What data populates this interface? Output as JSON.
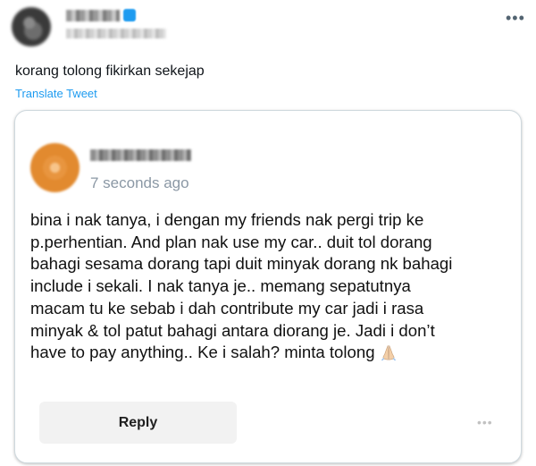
{
  "tweet": {
    "text": "korang tolong fikirkan sekejap",
    "translate_label": "Translate Tweet",
    "more_icon": "more-horizontal-icon"
  },
  "embedded_post": {
    "timestamp": "7 seconds ago",
    "message": "bina i nak tanya, i dengan my friends nak pergi trip ke\np.perhentian. And plan nak use my car.. duit tol dorang\nbahagi sesama dorang tapi duit minyak dorang nk bahagi\ninclude i sekali. I nak tanya je.. memang sepatutnya\nmacam tu ke sebab i dah contribute my car jadi i rasa\nminyak & tol patut bahagi antara diorang je. Jadi i don’t\nhave to pay anything.. Ke i salah? minta tolong",
    "emoji": "praying-hands-icon",
    "reply_label": "Reply",
    "more_icon": "more-horizontal-icon"
  },
  "colors": {
    "link": "#1d9bf0",
    "timestamp": "#8b98a5",
    "reply_bg": "#f2f2f2",
    "card_border": "#cfd9de"
  }
}
